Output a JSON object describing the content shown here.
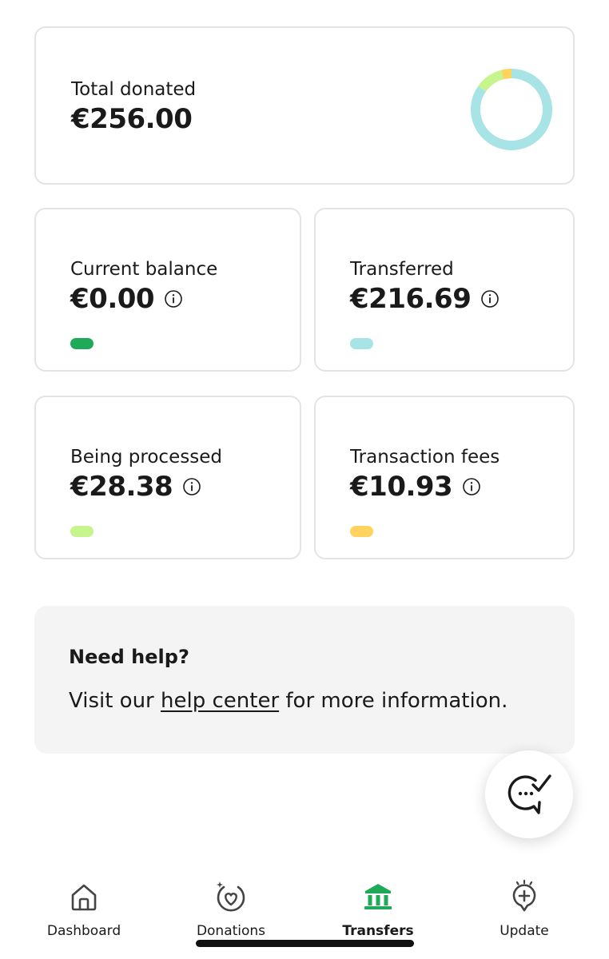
{
  "colors": {
    "current_balance": "#1faa59",
    "transferred": "#a8e3e6",
    "being_processed": "#c6f58e",
    "transaction_fees": "#ffd35e",
    "active_tab": "#1faa59"
  },
  "summary": {
    "total_label": "Total donated",
    "total_amount": "€256.00",
    "donut_segments": [
      {
        "name": "Transferred",
        "value": 216.69,
        "color": "#a8e3e6"
      },
      {
        "name": "Being processed",
        "value": 28.38,
        "color": "#c6f58e"
      },
      {
        "name": "Transaction fees",
        "value": 10.93,
        "color": "#ffd35e"
      }
    ]
  },
  "stats": {
    "current_balance": {
      "label": "Current balance",
      "amount": "€0.00"
    },
    "transferred": {
      "label": "Transferred",
      "amount": "€216.69"
    },
    "being_processed": {
      "label": "Being processed",
      "amount": "€28.38"
    },
    "transaction_fees": {
      "label": "Transaction fees",
      "amount": "€10.93"
    }
  },
  "help": {
    "title": "Need help?",
    "text_before": "Visit our ",
    "link": "help center",
    "text_after": " for more information."
  },
  "chat": {
    "icon": "chat-check-icon"
  },
  "tabs": [
    {
      "label": "Dashboard",
      "icon": "home-icon",
      "active": false
    },
    {
      "label": "Donations",
      "icon": "heart-sparkle-icon",
      "active": false
    },
    {
      "label": "Transfers",
      "icon": "bank-icon",
      "active": true
    },
    {
      "label": "Update",
      "icon": "add-pin-icon",
      "active": false
    }
  ]
}
